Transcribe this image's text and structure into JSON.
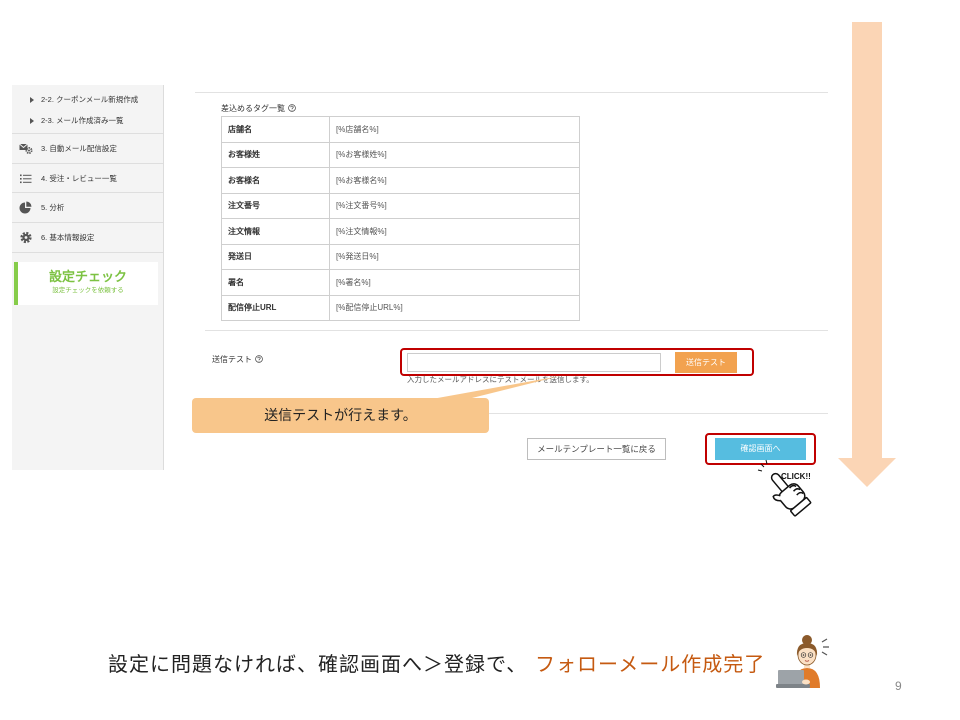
{
  "sidebar": {
    "subitems": [
      {
        "label": "2-2. クーポンメール新規作成"
      },
      {
        "label": "2-3. メール作成済み一覧"
      }
    ],
    "items": [
      {
        "icon": "auto-mail-settings-icon",
        "label": "3. 自動メール配信設定"
      },
      {
        "icon": "list-icon",
        "label": "4. 受注・レビュー一覧"
      },
      {
        "icon": "pie-chart-icon",
        "label": "5. 分析"
      },
      {
        "icon": "gear-icon",
        "label": "6. 基本情報設定"
      }
    ],
    "check": {
      "title": "設定チェック",
      "subtitle": "設定チェックを依頼する"
    }
  },
  "tags": {
    "heading": "差込めるタグ一覧",
    "help_icon": "help-icon",
    "rows": [
      {
        "name": "店舗名",
        "tag": "[%店舗名%]"
      },
      {
        "name": "お客様姓",
        "tag": "[%お客様姓%]"
      },
      {
        "name": "お客様名",
        "tag": "[%お客様名%]"
      },
      {
        "name": "注文番号",
        "tag": "[%注文番号%]"
      },
      {
        "name": "注文情報",
        "tag": "[%注文情報%]"
      },
      {
        "name": "発送日",
        "tag": "[%発送日%]"
      },
      {
        "name": "署名",
        "tag": "[%署名%]"
      },
      {
        "name": "配信停止URL",
        "tag": "[%配信停止URL%]"
      }
    ]
  },
  "send_test": {
    "label": "送信テスト",
    "help_icon": "help-icon",
    "email_value": "",
    "button_label": "送信テスト",
    "helper_text": "入力したメールアドレスにテストメールを送信します。"
  },
  "actions": {
    "back_label": "メールテンプレート一覧に戻る",
    "confirm_label": "確認画面へ"
  },
  "annotations": {
    "callout_text": "送信テストが行えます。",
    "click_label": "CLICK!!",
    "caption_text": "設定に問題なければ、確認画面へ＞登録で、",
    "caption_highlight": "フォローメール作成完了"
  },
  "page_number": "9",
  "colors": {
    "callout_bg": "#f8c68b",
    "scroll_arrow": "#fbd5b5",
    "highlight_frame": "#c00000",
    "send_button": "#f2a24f",
    "confirm_button": "#56bde0",
    "check_green": "#7cc242",
    "caption_highlight": "#c55a11"
  }
}
